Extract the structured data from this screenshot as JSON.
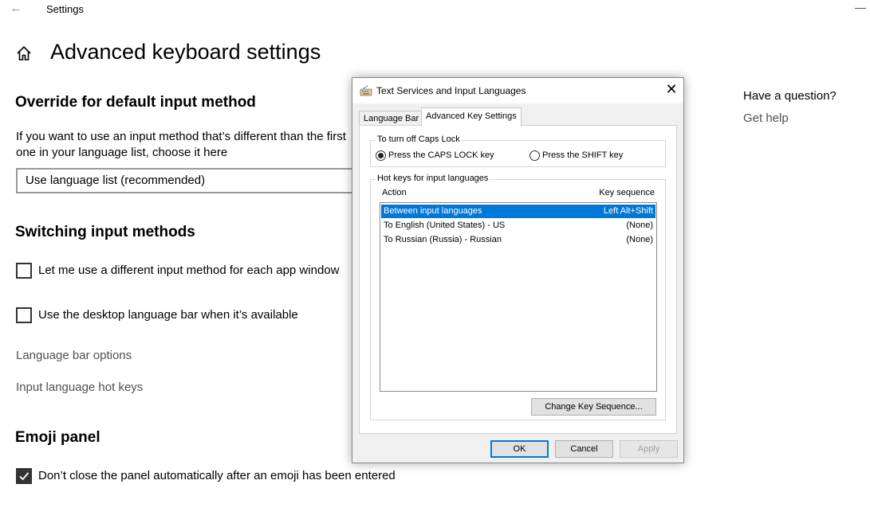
{
  "settings": {
    "app_title": "Settings",
    "page_title": "Advanced keyboard settings",
    "override": {
      "title": "Override for default input method",
      "description": "If you want to use an input method that’s different than the first one in your language list, choose it here",
      "combo_value": "Use language list (recommended)"
    },
    "switching": {
      "title": "Switching input methods",
      "option1": {
        "label": "Let me use a different input method for each app window",
        "checked": false
      },
      "option2": {
        "label": "Use the desktop language bar when it’s available",
        "checked": false
      },
      "language_bar_options": "Language bar options",
      "input_hot_keys": "Input language hot keys"
    },
    "emoji": {
      "title": "Emoji panel",
      "option": {
        "label": "Don’t close the panel automatically after an emoji has been entered",
        "checked": true
      }
    },
    "help": {
      "heading": "Have a question?",
      "link": "Get help"
    }
  },
  "dialog": {
    "title": "Text Services and Input Languages",
    "tabs": [
      {
        "label": "Language Bar",
        "active": false
      },
      {
        "label": "Advanced Key Settings",
        "active": true
      }
    ],
    "caps_lock": {
      "legend": "To turn off Caps Lock",
      "options": [
        {
          "label": "Press the CAPS LOCK key",
          "selected": true
        },
        {
          "label": "Press the SHIFT key",
          "selected": false
        }
      ]
    },
    "hotkeys": {
      "legend": "Hot keys for input languages",
      "col_action": "Action",
      "col_key": "Key sequence",
      "rows": [
        {
          "action": "Between input languages",
          "key": "Left Alt+Shift",
          "selected": true
        },
        {
          "action": "To English (United States) - US",
          "key": "(None)",
          "selected": false
        },
        {
          "action": "To Russian (Russia) - Russian",
          "key": "(None)",
          "selected": false
        }
      ],
      "change_button": "Change Key Sequence..."
    },
    "buttons": {
      "ok": "OK",
      "cancel": "Cancel",
      "apply": "Apply"
    },
    "colors": {
      "selection": "#0078d7",
      "dialog_bg": "#f0f0f0"
    }
  }
}
